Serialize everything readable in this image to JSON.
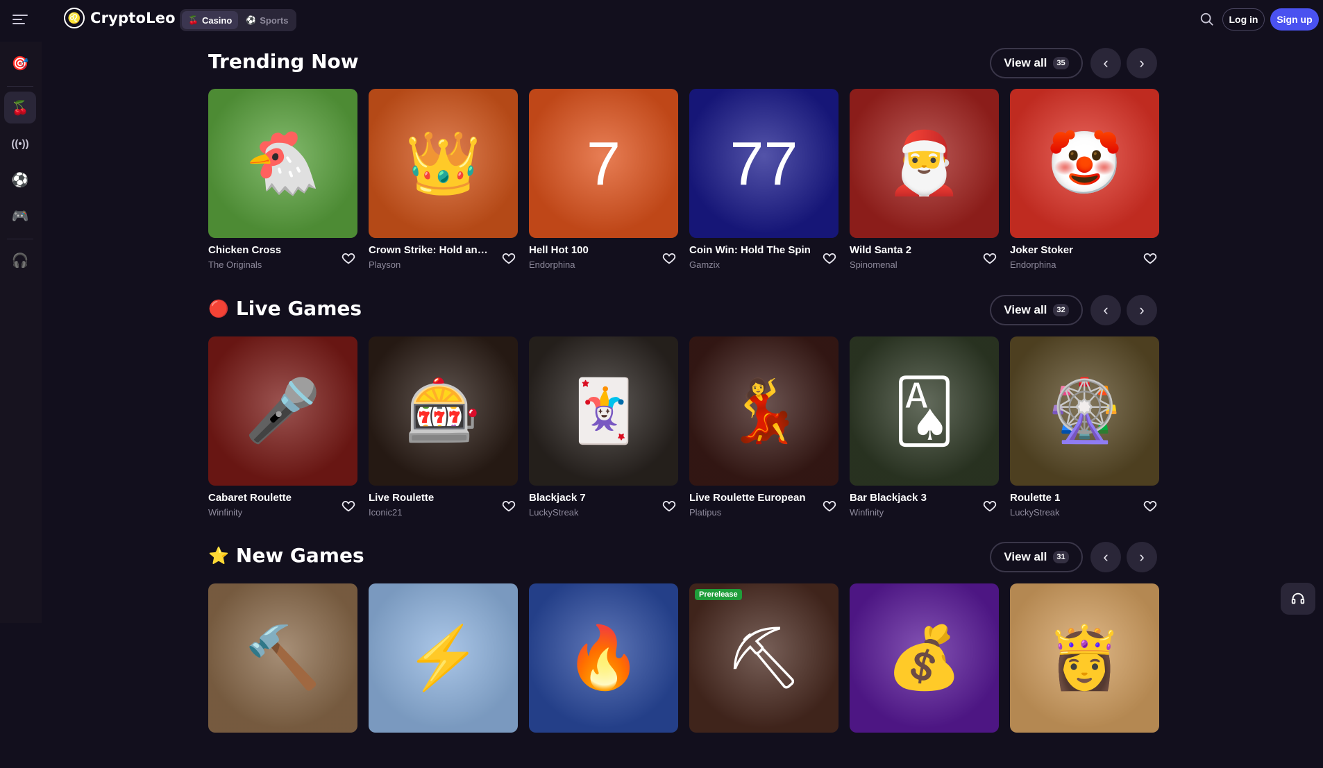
{
  "header": {
    "brand": "CryptoLeo",
    "logo_glyph": "♌",
    "tabs": [
      {
        "label": "Casino",
        "icon": "cherry-icon",
        "active": true
      },
      {
        "label": "Sports",
        "icon": "soccer-ball-icon",
        "active": false
      }
    ],
    "login_label": "Log in",
    "signup_label": "Sign up",
    "accent_color": "#4a52f0"
  },
  "sidebar": {
    "items": [
      {
        "name": "dart-target-icon",
        "glyph": "🎯"
      },
      {
        "name": "cherry-icon",
        "glyph": "🍒"
      },
      {
        "name": "live-broadcast-icon",
        "glyph": "((•))"
      },
      {
        "name": "soccer-ball-icon",
        "glyph": "⚽"
      },
      {
        "name": "gamepad-icon",
        "glyph": "🎮"
      },
      {
        "name": "headset-icon",
        "glyph": "🎧"
      }
    ]
  },
  "sections": [
    {
      "title": "Trending Now",
      "icon": "",
      "view_all": "View all",
      "count": "35",
      "games": [
        {
          "title": "Chicken Cross",
          "provider": "The Originals",
          "bg": "#5aa33d",
          "art": "🐔"
        },
        {
          "title": "Crown Strike: Hold and Win",
          "provider": "Playson",
          "bg": "#d4561b",
          "art": "👑"
        },
        {
          "title": "Hell Hot 100",
          "provider": "Endorphina",
          "bg": "#e0531c",
          "art": "7"
        },
        {
          "title": "Coin Win: Hold The Spin",
          "provider": "Gamzix",
          "bg": "#1a1a8c",
          "art": "77"
        },
        {
          "title": "Wild Santa 2",
          "provider": "Spinomenal",
          "bg": "#a3221e",
          "art": "🎅"
        },
        {
          "title": "Joker Stoker",
          "provider": "Endorphina",
          "bg": "#e03226",
          "art": "🤡"
        }
      ]
    },
    {
      "title": "Live Games",
      "icon": "live-dot-icon",
      "view_all": "View all",
      "count": "32",
      "games": [
        {
          "title": "Cabaret Roulette",
          "provider": "Winfinity",
          "bg": "#7a1a16",
          "art": "🎤"
        },
        {
          "title": "Live Roulette",
          "provider": "Iconic21",
          "bg": "#2b1d16",
          "art": "🎰"
        },
        {
          "title": "Blackjack 7",
          "provider": "LuckyStreak",
          "bg": "#2a2420",
          "art": "🃏"
        },
        {
          "title": "Live Roulette European",
          "provider": "Platipus",
          "bg": "#3a1a16",
          "art": "💃"
        },
        {
          "title": "Bar Blackjack 3",
          "provider": "Winfinity",
          "bg": "#2f3a26",
          "art": "🂡"
        },
        {
          "title": "Roulette 1",
          "provider": "LuckyStreak",
          "bg": "#5a4a26",
          "art": "🎡"
        }
      ]
    },
    {
      "title": "New Games",
      "icon": "star-icon",
      "view_all": "View all",
      "count": "31",
      "games": [
        {
          "title": "",
          "provider": "",
          "bg": "#8a6a4a",
          "art": "🔨",
          "badge": ""
        },
        {
          "title": "",
          "provider": "",
          "bg": "#8fb4e0",
          "art": "⚡",
          "badge": ""
        },
        {
          "title": "",
          "provider": "",
          "bg": "#2a4aa0",
          "art": "🔥",
          "badge": ""
        },
        {
          "title": "",
          "provider": "",
          "bg": "#4a2a20",
          "art": "⛏",
          "badge": "Prerelease"
        },
        {
          "title": "",
          "provider": "",
          "bg": "#5a1a9a",
          "art": "💰",
          "badge": ""
        },
        {
          "title": "",
          "provider": "",
          "bg": "#d4a060",
          "art": "👸",
          "badge": ""
        }
      ]
    }
  ]
}
